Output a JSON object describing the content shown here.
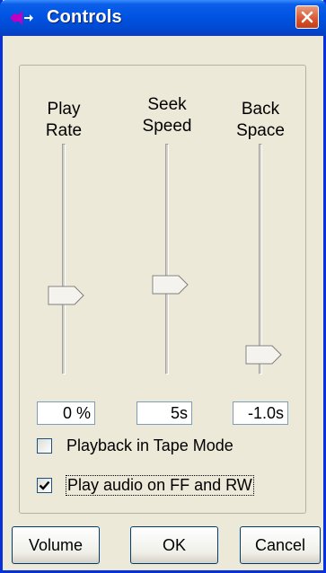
{
  "window": {
    "title": "Controls",
    "icon": "speaker-arrows-icon",
    "close_icon": "close-icon"
  },
  "sliders": [
    {
      "label_line1": "Play",
      "label_line2": "Rate",
      "value": "0 %"
    },
    {
      "label_line1": "Seek",
      "label_line2": "Speed",
      "value": "5s"
    },
    {
      "label_line1": "Back",
      "label_line2": "Space",
      "value": "-1.0s"
    }
  ],
  "checkboxes": [
    {
      "label": "Playback in Tape Mode",
      "checked": false
    },
    {
      "label": "Play audio on FF and RW",
      "checked": true
    }
  ],
  "buttons": {
    "volume": "Volume",
    "ok": "OK",
    "cancel": "Cancel"
  },
  "colors": {
    "titlebar": "#0054e3",
    "close": "#d7552f",
    "dialog_bg": "#ece9d8",
    "icon_accent": "#c000c0"
  }
}
